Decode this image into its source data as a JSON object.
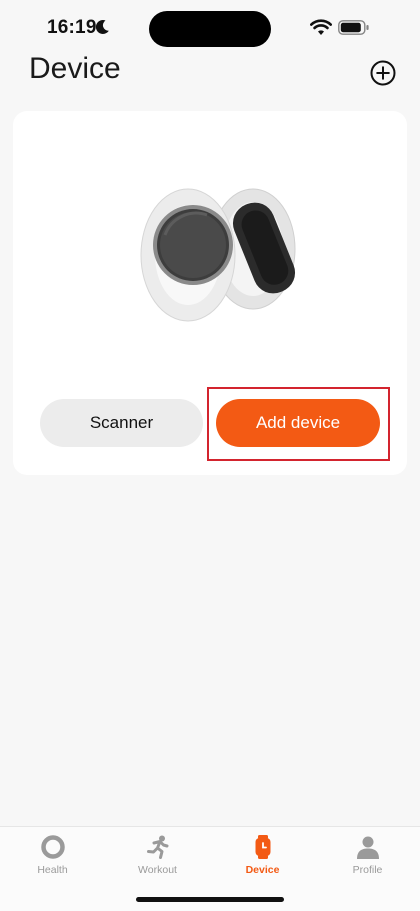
{
  "status_bar": {
    "time": "16:19",
    "icons": [
      "moon-icon",
      "wifi-icon",
      "battery-icon"
    ]
  },
  "header": {
    "title": "Device",
    "add_icon": "plus-circle-icon"
  },
  "device_card": {
    "illustration": "smartwatch-and-band-image",
    "scanner_label": "Scanner",
    "add_device_label": "Add device"
  },
  "tab_bar": {
    "tabs": [
      {
        "label": "Health",
        "icon": "ring-icon",
        "active": false
      },
      {
        "label": "Workout",
        "icon": "runner-icon",
        "active": false
      },
      {
        "label": "Device",
        "icon": "watch-icon",
        "active": true
      },
      {
        "label": "Profile",
        "icon": "person-icon",
        "active": false
      }
    ]
  },
  "colors": {
    "accent": "#f35a14",
    "highlight_box": "#d3242e",
    "background": "#f7f7f7",
    "card": "#ffffff",
    "inactive_tab": "#9a9a9a"
  }
}
